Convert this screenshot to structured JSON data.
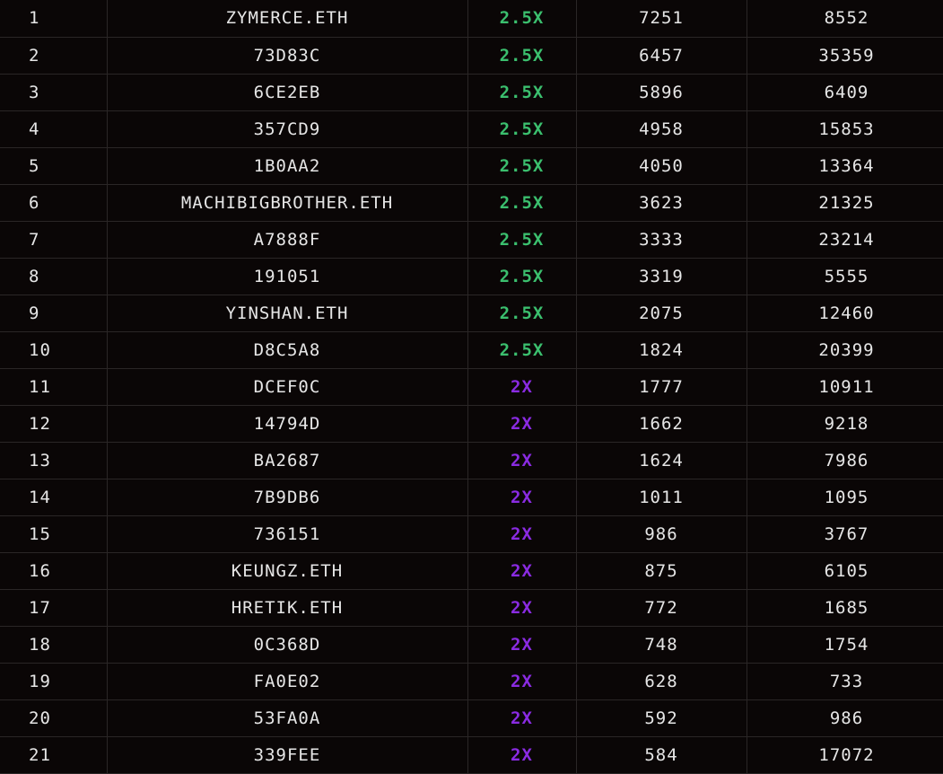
{
  "colors": {
    "background": "#0a0606",
    "text": "#e6e6e6",
    "grid": "#2a2626",
    "multiplier_high": "#3bbf6e",
    "multiplier_low": "#8a2be2"
  },
  "rows": [
    {
      "rank": "1",
      "name": "ZYMERCE.ETH",
      "multiplier": "2.5X",
      "tier": "green",
      "value_a": "7251",
      "value_b": "8552"
    },
    {
      "rank": "2",
      "name": "73D83C",
      "multiplier": "2.5X",
      "tier": "green",
      "value_a": "6457",
      "value_b": "35359"
    },
    {
      "rank": "3",
      "name": "6CE2EB",
      "multiplier": "2.5X",
      "tier": "green",
      "value_a": "5896",
      "value_b": "6409"
    },
    {
      "rank": "4",
      "name": "357CD9",
      "multiplier": "2.5X",
      "tier": "green",
      "value_a": "4958",
      "value_b": "15853"
    },
    {
      "rank": "5",
      "name": "1B0AA2",
      "multiplier": "2.5X",
      "tier": "green",
      "value_a": "4050",
      "value_b": "13364"
    },
    {
      "rank": "6",
      "name": "MACHIBIGBROTHER.ETH",
      "multiplier": "2.5X",
      "tier": "green",
      "value_a": "3623",
      "value_b": "21325"
    },
    {
      "rank": "7",
      "name": "A7888F",
      "multiplier": "2.5X",
      "tier": "green",
      "value_a": "3333",
      "value_b": "23214"
    },
    {
      "rank": "8",
      "name": "191051",
      "multiplier": "2.5X",
      "tier": "green",
      "value_a": "3319",
      "value_b": "5555"
    },
    {
      "rank": "9",
      "name": "YINSHAN.ETH",
      "multiplier": "2.5X",
      "tier": "green",
      "value_a": "2075",
      "value_b": "12460"
    },
    {
      "rank": "10",
      "name": "D8C5A8",
      "multiplier": "2.5X",
      "tier": "green",
      "value_a": "1824",
      "value_b": "20399"
    },
    {
      "rank": "11",
      "name": "DCEF0C",
      "multiplier": "2X",
      "tier": "purple",
      "value_a": "1777",
      "value_b": "10911"
    },
    {
      "rank": "12",
      "name": "14794D",
      "multiplier": "2X",
      "tier": "purple",
      "value_a": "1662",
      "value_b": "9218"
    },
    {
      "rank": "13",
      "name": "BA2687",
      "multiplier": "2X",
      "tier": "purple",
      "value_a": "1624",
      "value_b": "7986"
    },
    {
      "rank": "14",
      "name": "7B9DB6",
      "multiplier": "2X",
      "tier": "purple",
      "value_a": "1011",
      "value_b": "1095"
    },
    {
      "rank": "15",
      "name": "736151",
      "multiplier": "2X",
      "tier": "purple",
      "value_a": "986",
      "value_b": "3767"
    },
    {
      "rank": "16",
      "name": "KEUNGZ.ETH",
      "multiplier": "2X",
      "tier": "purple",
      "value_a": "875",
      "value_b": "6105"
    },
    {
      "rank": "17",
      "name": "HRETIK.ETH",
      "multiplier": "2X",
      "tier": "purple",
      "value_a": "772",
      "value_b": "1685"
    },
    {
      "rank": "18",
      "name": "0C368D",
      "multiplier": "2X",
      "tier": "purple",
      "value_a": "748",
      "value_b": "1754"
    },
    {
      "rank": "19",
      "name": "FA0E02",
      "multiplier": "2X",
      "tier": "purple",
      "value_a": "628",
      "value_b": "733"
    },
    {
      "rank": "20",
      "name": "53FA0A",
      "multiplier": "2X",
      "tier": "purple",
      "value_a": "592",
      "value_b": "986"
    },
    {
      "rank": "21",
      "name": "339FEE",
      "multiplier": "2X",
      "tier": "purple",
      "value_a": "584",
      "value_b": "17072"
    }
  ]
}
